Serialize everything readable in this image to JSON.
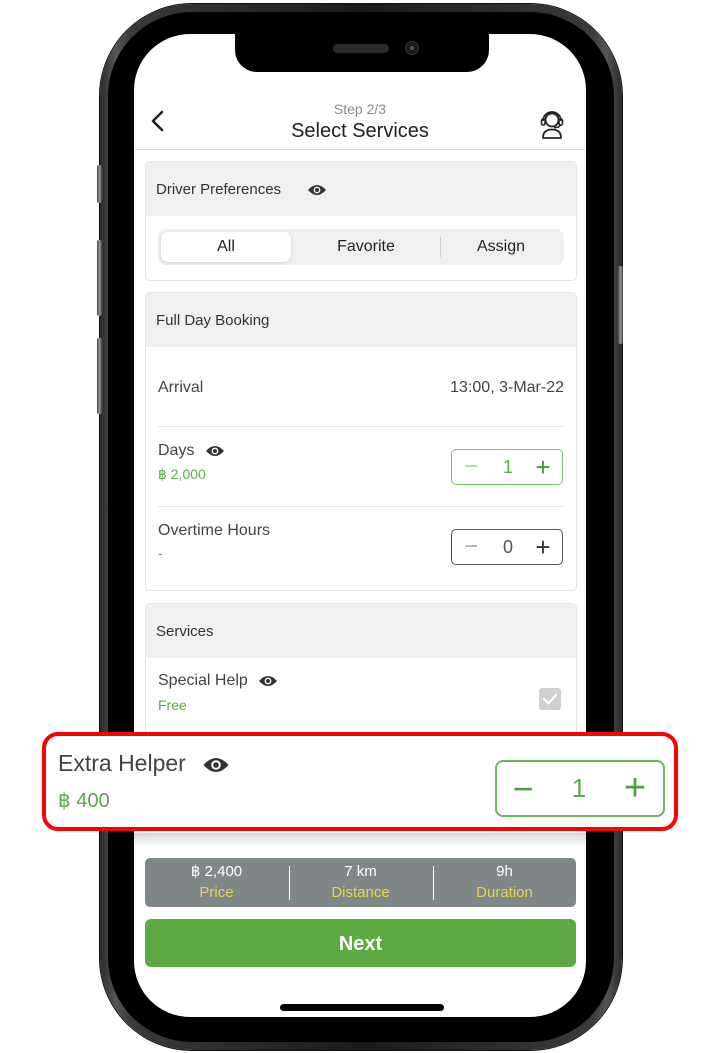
{
  "header": {
    "step": "Step 2/3",
    "title": "Select Services",
    "back_icon": "chevron-left-icon",
    "support_icon": "headset-support-icon"
  },
  "driver_preferences": {
    "title": "Driver Preferences",
    "info_icon": "eye-icon",
    "options": [
      {
        "label": "All",
        "selected": true
      },
      {
        "label": "Favorite",
        "selected": false
      },
      {
        "label": "Assign",
        "selected": false
      }
    ]
  },
  "full_day_booking": {
    "title": "Full Day Booking",
    "arrival": {
      "label": "Arrival",
      "value": "13:00, 3-Mar-22"
    },
    "days": {
      "label": "Days",
      "price": "฿ 2,000",
      "value": "1",
      "minus": "−",
      "plus": "+"
    },
    "overtime": {
      "label": "Overtime Hours",
      "price": "-",
      "value": "0",
      "minus": "−",
      "plus": "+"
    }
  },
  "services": {
    "title": "Services",
    "special_help": {
      "label": "Special Help",
      "price": "Free",
      "checked": true
    },
    "extra_helper": {
      "label": "Extra Helper",
      "price": "฿ 400",
      "value": "1",
      "minus": "−",
      "plus": "+"
    }
  },
  "summary": {
    "price": {
      "value": "฿ 2,400",
      "label": "Price"
    },
    "distance": {
      "value": "7 km",
      "label": "Distance"
    },
    "duration": {
      "value": "9h",
      "label": "Duration"
    }
  },
  "next_button": "Next",
  "colors": {
    "accent_green": "#5daa42",
    "highlight_red": "#ff0000",
    "summary_gray": "#7f8788",
    "summary_label_yellow": "#e8d34c"
  }
}
